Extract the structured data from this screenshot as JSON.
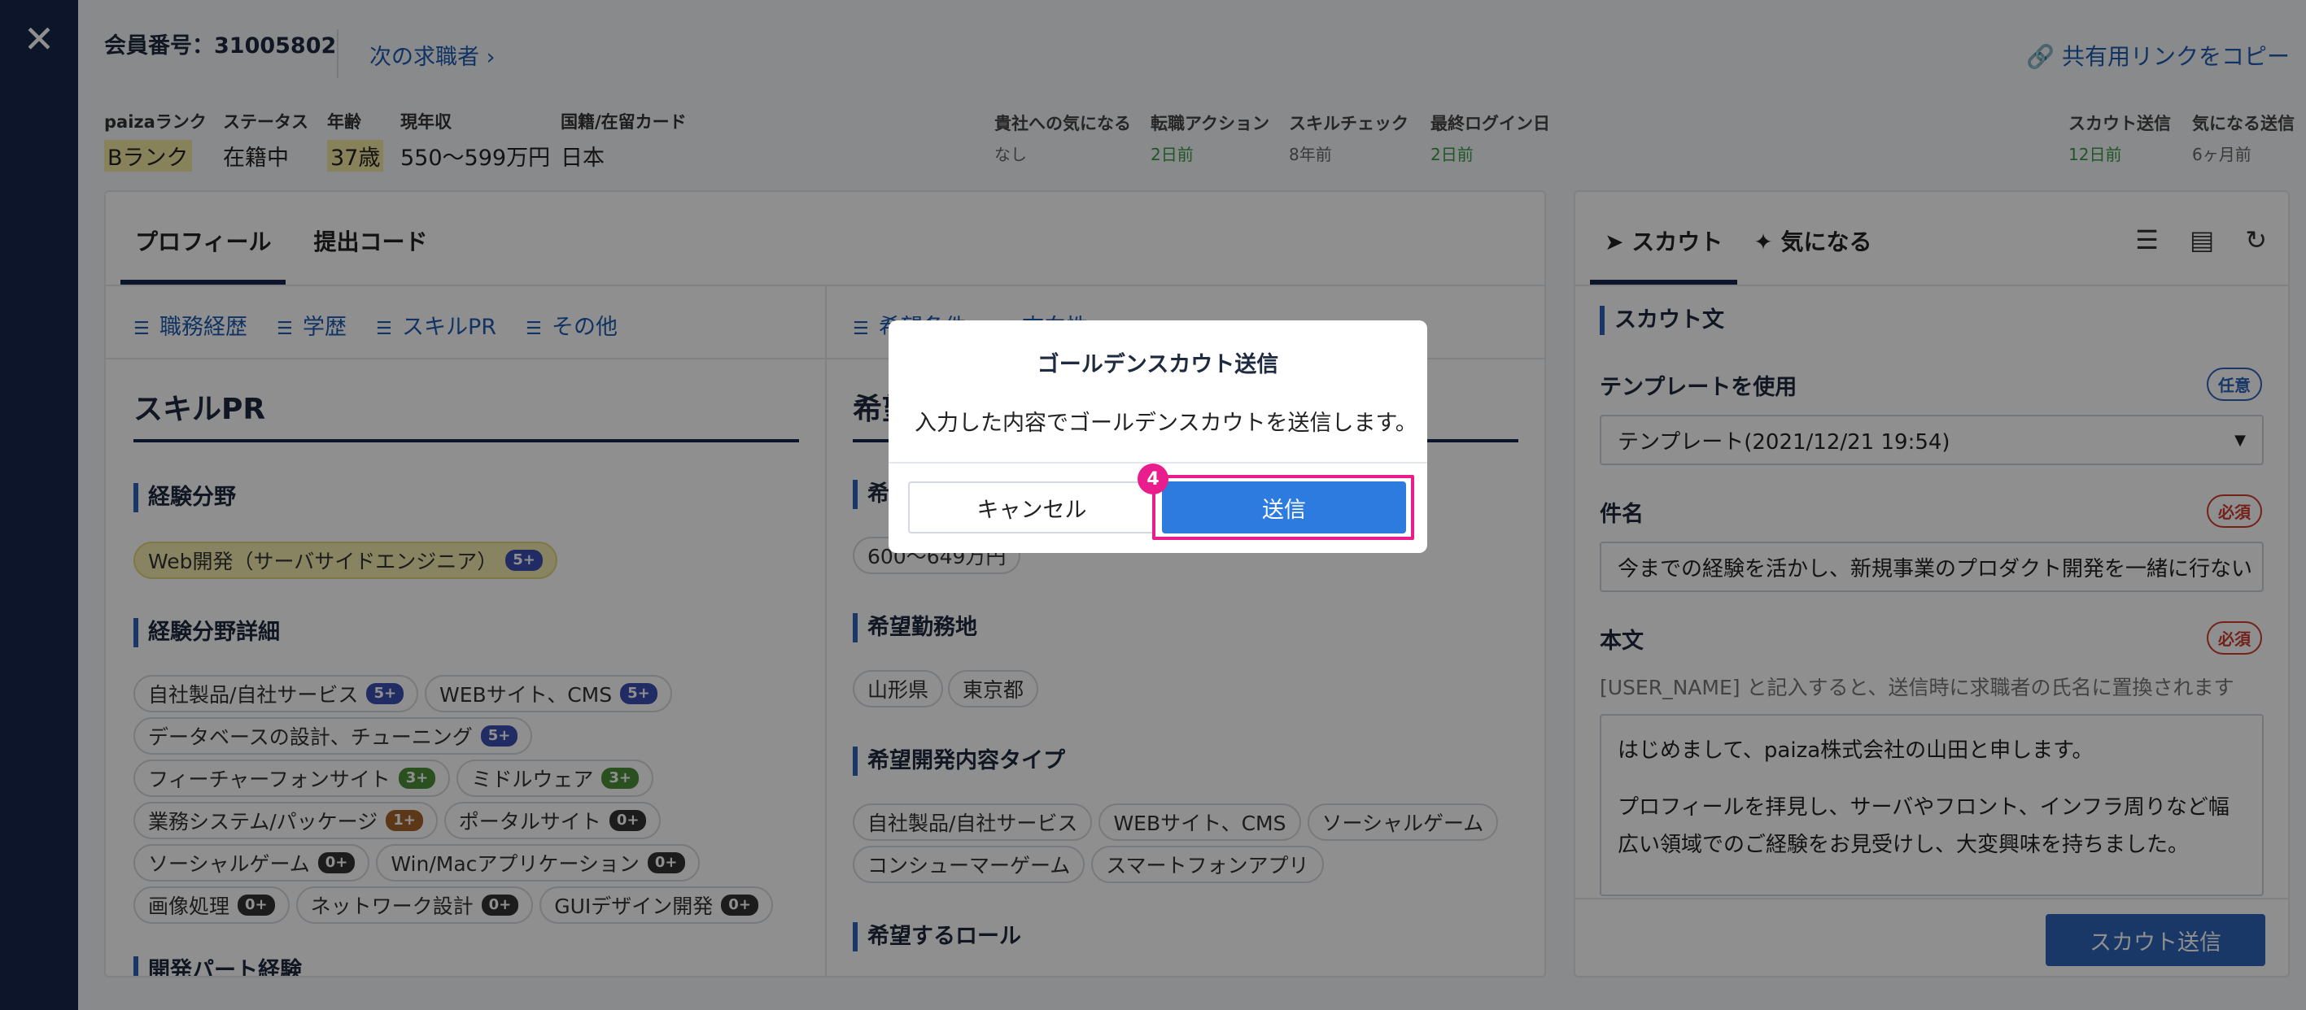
{
  "header": {
    "member_no": "会員番号：31005802",
    "next_candidate": "次の求職者",
    "copy_link": "共有用リンクをコピー"
  },
  "stats": [
    {
      "label": "paizaランク",
      "value": "Bランク",
      "highlight": true
    },
    {
      "label": "ステータス",
      "value": "在籍中",
      "highlight": false
    },
    {
      "label": "年齢",
      "value": "37歳",
      "highlight": true
    },
    {
      "label": "現年収",
      "value": "550〜599万円",
      "highlight": false
    },
    {
      "label": "国籍/在留カード",
      "value": "日本",
      "highlight": false
    }
  ],
  "activity": [
    {
      "label": "貴社への気になる",
      "value": "なし",
      "green": false
    },
    {
      "label": "転職アクション",
      "value": "2日前",
      "green": true
    },
    {
      "label": "スキルチェック",
      "value": "8年前",
      "green": false
    },
    {
      "label": "最終ログイン日",
      "value": "2日前",
      "green": true
    }
  ],
  "sent": [
    {
      "label": "スカウト送信",
      "value": "12日前",
      "green": true
    },
    {
      "label": "気になる送信",
      "value": "6ヶ月前",
      "green": false
    }
  ],
  "left_tabs": [
    "プロフィール",
    "提出コード"
  ],
  "sub_nav": [
    "職務経歴",
    "学歴",
    "スキルPR",
    "その他"
  ],
  "mid_sub_nav": [
    "希望条件",
    "志向性"
  ],
  "skill_pr": {
    "title": "スキルPR",
    "field_title": "経験分野",
    "field_chip": {
      "label": "Web開発（サーバサイドエンジニア）",
      "level": "5+"
    },
    "detail_title": "経験分野詳細",
    "detail_chips": [
      {
        "label": "自社製品/自社サービス",
        "level": "5+",
        "cls": "lv5"
      },
      {
        "label": "WEBサイト、CMS",
        "level": "5+",
        "cls": "lv5"
      },
      {
        "label": "データベースの設計、チューニング",
        "level": "5+",
        "cls": "lv5"
      },
      {
        "label": "フィーチャーフォンサイト",
        "level": "3+",
        "cls": "lv3"
      },
      {
        "label": "ミドルウェア",
        "level": "3+",
        "cls": "lv3"
      },
      {
        "label": "業務システム/パッケージ",
        "level": "1+",
        "cls": "lv1"
      },
      {
        "label": "ポータルサイト",
        "level": "0+",
        "cls": "lv0"
      },
      {
        "label": "ソーシャルゲーム",
        "level": "0+",
        "cls": "lv0"
      },
      {
        "label": "Win/Macアプリケーション",
        "level": "0+",
        "cls": "lv0"
      },
      {
        "label": "画像処理",
        "level": "0+",
        "cls": "lv0"
      },
      {
        "label": "ネットワーク設計",
        "level": "0+",
        "cls": "lv0"
      },
      {
        "label": "GUIデザイン開発",
        "level": "0+",
        "cls": "lv0"
      }
    ],
    "next_title": "開発パート経験"
  },
  "wish": {
    "title": "希望",
    "salary_title": "希望",
    "salary_value": "600〜649万円",
    "location_title": "希望勤務地",
    "locations": [
      "山形県",
      "東京都"
    ],
    "dev_type_title": "希望開発内容タイプ",
    "dev_types": [
      "自社製品/自社サービス",
      "WEBサイト、CMS",
      "ソーシャルゲーム",
      "コンシューマーゲーム",
      "スマートフォンアプリ"
    ],
    "role_title": "希望するロール"
  },
  "scout_panel": {
    "tab_scout": "スカウト",
    "tab_interest": "気になる",
    "section": "スカウト文",
    "template_label": "テンプレートを使用",
    "template_badge": "任意",
    "template_value": "テンプレート(2021/12/21 19:54)",
    "subject_label": "件名",
    "subject_badge": "必須",
    "subject_value": "今までの経験を活かし、新規事業のプロダクト開発を一緒に行ない",
    "body_label": "本文",
    "body_badge": "必須",
    "body_hint": "[USER_NAME] と記入すると、送信時に求職者の氏名に置換されます",
    "body_line1": "はじめまして、paiza株式会社の山田と申します。",
    "body_line2": "プロフィールを拝見し、サーバやフロント、インフラ周りなど幅",
    "body_line3": "広い領域でのご経験をお見受けし、大変興味を持ちました。",
    "send_button": "スカウト送信"
  },
  "modal": {
    "title": "ゴールデンスカウト送信",
    "message": "入力した内容でゴールデンスカウトを送信します。",
    "cancel": "キャンセル",
    "send": "送信",
    "step": "4"
  },
  "colors": {
    "accent": "#2e63b8",
    "navy": "#16274a",
    "highlight": "#e91e8c"
  }
}
